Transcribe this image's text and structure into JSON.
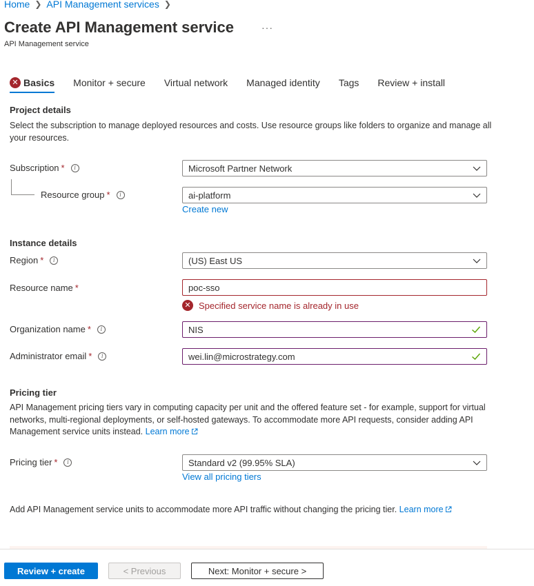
{
  "breadcrumb": {
    "home": "Home",
    "parent": "API Management services"
  },
  "header": {
    "title": "Create API Management service",
    "more": "···",
    "subtitle": "API Management service"
  },
  "tabs": [
    {
      "label": "Basics",
      "active": true,
      "has_error": true
    },
    {
      "label": "Monitor + secure"
    },
    {
      "label": "Virtual network"
    },
    {
      "label": "Managed identity"
    },
    {
      "label": "Tags"
    },
    {
      "label": "Review + install"
    }
  ],
  "project": {
    "heading": "Project details",
    "description": "Select the subscription to manage deployed resources and costs. Use resource groups like folders to organize and manage all your resources.",
    "subscription": {
      "label": "Subscription",
      "required": "*",
      "value": "Microsoft Partner Network"
    },
    "resource_group": {
      "label": "Resource group",
      "required": "*",
      "value": "ai-platform",
      "create_new": "Create new"
    }
  },
  "instance": {
    "heading": "Instance details",
    "region": {
      "label": "Region",
      "required": "*",
      "value": "(US) East US"
    },
    "resource_name": {
      "label": "Resource name",
      "required": "*",
      "value": "poc-sso",
      "error": "Specified service name is already in use"
    },
    "org_name": {
      "label": "Organization name",
      "required": "*",
      "value": "NIS"
    },
    "admin_email": {
      "label": "Administrator email",
      "required": "*",
      "value": "wei.lin@microstrategy.com"
    }
  },
  "pricing": {
    "heading": "Pricing tier",
    "description": "API Management pricing tiers vary in computing capacity per unit and the offered feature set - for example, support for virtual networks, multi-regional deployments, or self-hosted gateways. To accommodate more API requests, consider adding API Management service units instead.",
    "learn_more": "Learn more",
    "tier": {
      "label": "Pricing tier",
      "required": "*",
      "value": "Standard v2 (99.95% SLA)",
      "view_all": "View all pricing tiers"
    },
    "units_note": "Add API Management service units to accommodate more API traffic without changing the pricing tier.",
    "units_learn_more": "Learn more"
  },
  "footer": {
    "review_create": "Review + create",
    "previous": "< Previous",
    "next": "Next: Monitor + secure >"
  },
  "colors": {
    "accent": "#0078d4",
    "error": "#a4262c",
    "valid_check": "#57a300",
    "text": "#323130"
  }
}
